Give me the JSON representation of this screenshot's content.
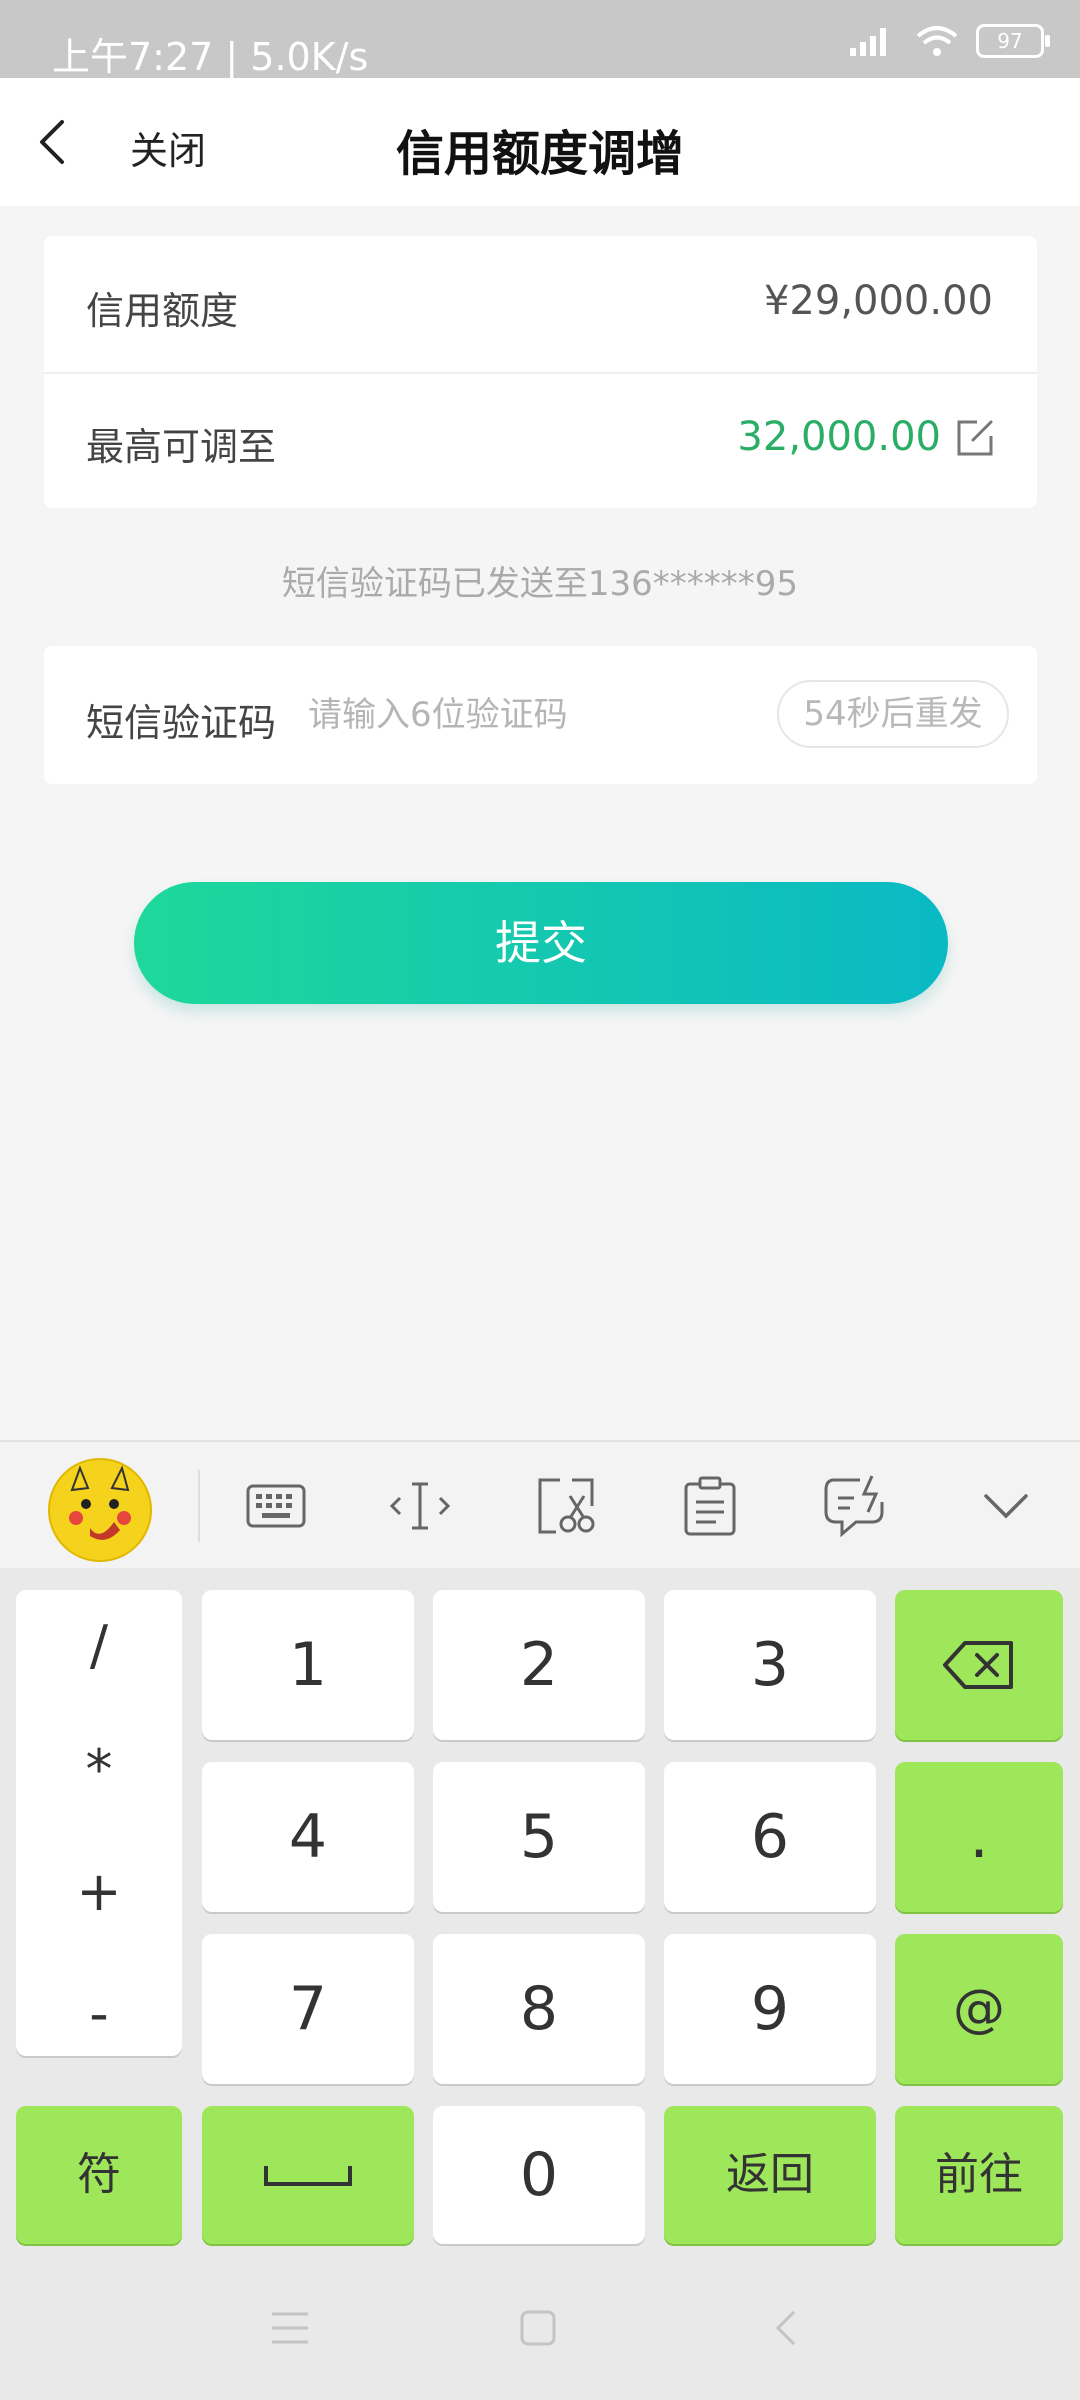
{
  "status_bar": {
    "left_text": "上午7:27 | 5.0K/s",
    "battery": "97"
  },
  "header": {
    "close_label": "关闭",
    "title": "信用额度调增"
  },
  "credit": {
    "limit_label": "信用额度",
    "limit_value": "¥29,000.00",
    "max_label": "最高可调至",
    "max_value": "32,000.00"
  },
  "sms": {
    "hint": "短信验证码已发送至136******95",
    "label": "短信验证码",
    "placeholder": "请输入6位验证码",
    "resend": "54秒后重发"
  },
  "submit_label": "提交",
  "keyboard": {
    "symbols": [
      "/",
      "*",
      "+",
      "-"
    ],
    "digits": [
      "1",
      "2",
      "3",
      "4",
      "5",
      "6",
      "7",
      "8",
      "9",
      "0"
    ],
    "dot": ".",
    "at": "@",
    "fu": "符",
    "back": "返回",
    "go": "前往"
  },
  "colors": {
    "accent_green": "#2aae66",
    "key_green": "#9ee65a",
    "button_gradient_start": "#1ed89a",
    "button_gradient_end": "#0ab9c4"
  }
}
